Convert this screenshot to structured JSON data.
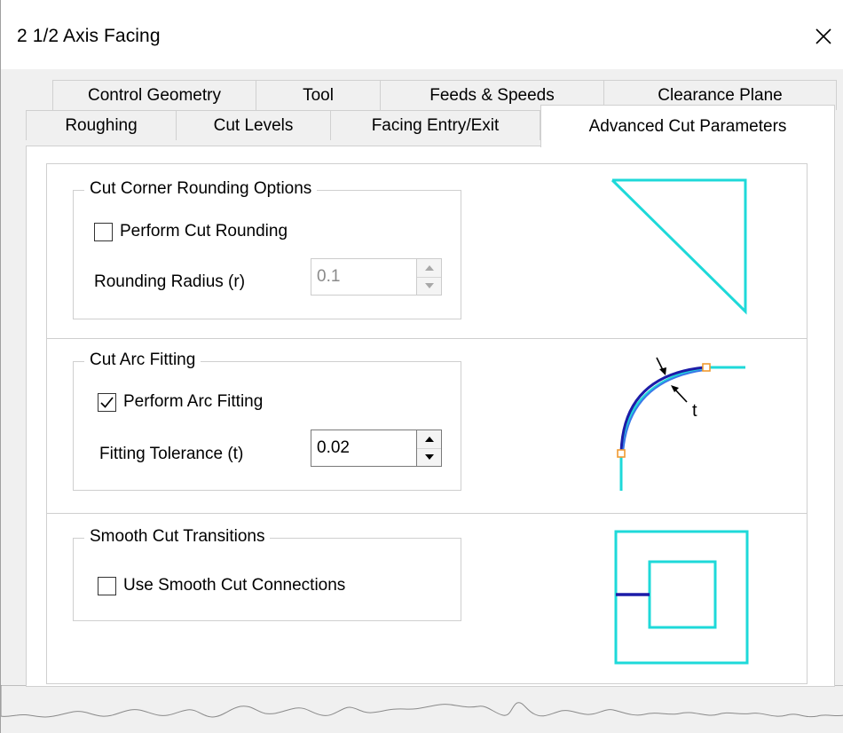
{
  "window": {
    "title": "2 1/2 Axis Facing",
    "close_glyph": "×"
  },
  "tabs": {
    "row1": [
      {
        "label": "Control Geometry"
      },
      {
        "label": "Tool"
      },
      {
        "label": "Feeds & Speeds"
      },
      {
        "label": "Clearance Plane"
      }
    ],
    "row2": [
      {
        "label": "Roughing"
      },
      {
        "label": "Cut Levels"
      },
      {
        "label": "Facing Entry/Exit"
      },
      {
        "label": "Advanced Cut Parameters",
        "active": true
      }
    ]
  },
  "corner_rounding": {
    "title": "Cut Corner Rounding Options",
    "checkbox_label": "Perform Cut Rounding",
    "checked": false,
    "radius_label": "Rounding Radius (r)",
    "radius_value": "0.1",
    "enabled": false
  },
  "arc_fitting": {
    "title": "Cut Arc Fitting",
    "checkbox_label": "Perform Arc Fitting",
    "checked": true,
    "tolerance_label": "Fitting Tolerance (t)",
    "tolerance_value": "0.02",
    "diagram_label": "t"
  },
  "smooth_transitions": {
    "title": "Smooth Cut Transitions",
    "checkbox_label": "Use Smooth Cut Connections",
    "checked": false
  },
  "colors": {
    "diagram_cyan": "#1ed9d9",
    "diagram_blue": "#1c1ca8",
    "diagram_marker": "#f09a30"
  }
}
